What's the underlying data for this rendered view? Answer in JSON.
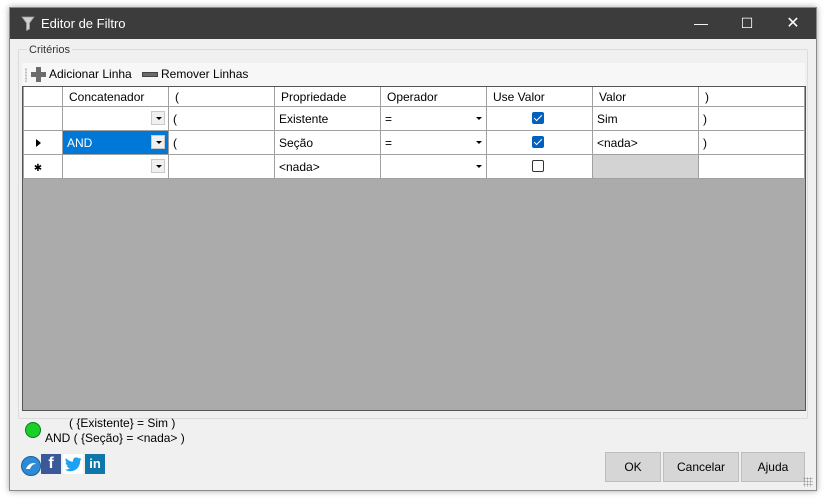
{
  "window": {
    "title": "Editor de Filtro",
    "controls": {
      "minimize": "—",
      "maximize": "☐",
      "close": "✕"
    }
  },
  "group_label": "Critérios",
  "toolbar": {
    "add_label": "Adicionar Linha",
    "remove_label": "Remover Linhas"
  },
  "grid": {
    "columns": [
      "Concatenador",
      "(",
      "Propriedade",
      "Operador",
      "Use Valor",
      "Valor",
      ")"
    ],
    "rows": [
      {
        "indicator": "",
        "concat": "",
        "open": "(",
        "property": "Existente",
        "operator": "=",
        "use_value": true,
        "value": "Sim",
        "close": ")"
      },
      {
        "indicator": "current",
        "concat": "AND",
        "open": "(",
        "property": "Seção",
        "operator": "=",
        "use_value": true,
        "value": "<nada>",
        "close": ")"
      },
      {
        "indicator": "new",
        "concat": "",
        "open": "",
        "property": "<nada>",
        "operator": "",
        "use_value": false,
        "value": "",
        "close": ""
      }
    ]
  },
  "status": {
    "color": "#1bcf2a",
    "expression_line1": "( {Existente} = Sim )",
    "expression_line2": "AND ( {Seção} = <nada> )"
  },
  "social": {
    "facebook": "f",
    "twitter": "🐦",
    "linkedin": "in"
  },
  "buttons": {
    "ok": "OK",
    "cancel": "Cancelar",
    "help": "Ajuda"
  }
}
